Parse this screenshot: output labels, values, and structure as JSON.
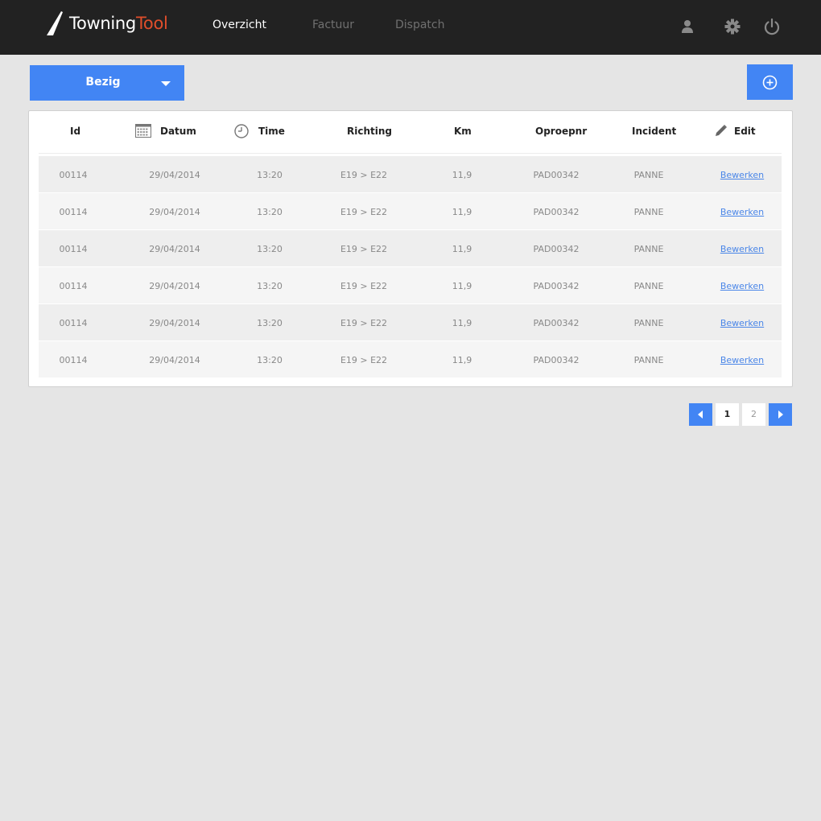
{
  "app": {
    "logo_part1": "Towning",
    "logo_part2": "Tool"
  },
  "nav": {
    "items": [
      {
        "label": "Overzicht",
        "active": true
      },
      {
        "label": "Factuur",
        "active": false
      },
      {
        "label": "Dispatch",
        "active": false
      }
    ],
    "icons": [
      "user-icon",
      "gear-icon",
      "power-icon"
    ]
  },
  "toolbar": {
    "status_label": "Bezig",
    "add_icon": "plus-circle-icon"
  },
  "table": {
    "columns": [
      "Id",
      "Datum",
      "Time",
      "Richting",
      "Km",
      "Oproepnr",
      "Incident",
      "Edit"
    ],
    "column_icons": {
      "Datum": "calendar-icon",
      "Time": "clock-icon",
      "Edit": "pencil-icon"
    },
    "rows": [
      {
        "id": "00114",
        "datum": "29/04/2014",
        "time": "13:20",
        "richting": "E19 > E22",
        "km": "11,9",
        "oproepnr": "PAD00342",
        "incident": "PANNE",
        "edit": "Bewerken"
      },
      {
        "id": "00114",
        "datum": "29/04/2014",
        "time": "13:20",
        "richting": "E19 > E22",
        "km": "11,9",
        "oproepnr": "PAD00342",
        "incident": "PANNE",
        "edit": "Bewerken"
      },
      {
        "id": "00114",
        "datum": "29/04/2014",
        "time": "13:20",
        "richting": "E19 > E22",
        "km": "11,9",
        "oproepnr": "PAD00342",
        "incident": "PANNE",
        "edit": "Bewerken"
      },
      {
        "id": "00114",
        "datum": "29/04/2014",
        "time": "13:20",
        "richting": "E19 > E22",
        "km": "11,9",
        "oproepnr": "PAD00342",
        "incident": "PANNE",
        "edit": "Bewerken"
      },
      {
        "id": "00114",
        "datum": "29/04/2014",
        "time": "13:20",
        "richting": "E19 > E22",
        "km": "11,9",
        "oproepnr": "PAD00342",
        "incident": "PANNE",
        "edit": "Bewerken"
      },
      {
        "id": "00114",
        "datum": "29/04/2014",
        "time": "13:20",
        "richting": "E19 > E22",
        "km": "11,9",
        "oproepnr": "PAD00342",
        "incident": "PANNE",
        "edit": "Bewerken"
      }
    ]
  },
  "pagination": {
    "pages": [
      "1",
      "2"
    ],
    "current": "1"
  },
  "colors": {
    "accent": "#4285f4",
    "topbar": "#222222",
    "logo_highlight": "#e04e2b",
    "link": "#4a86e8"
  }
}
